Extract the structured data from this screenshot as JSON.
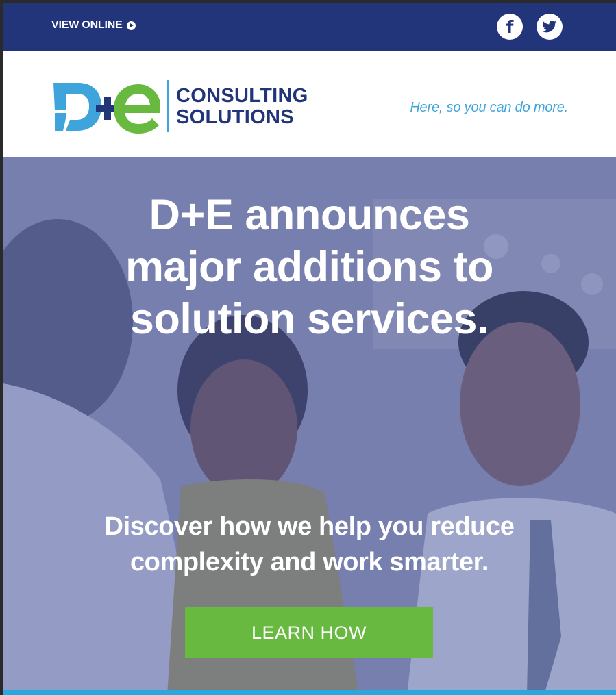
{
  "topbar": {
    "view_online_label": "VIEW ONLINE",
    "social": [
      {
        "icon": "facebook-icon",
        "glyph": "f"
      },
      {
        "icon": "twitter-icon"
      }
    ]
  },
  "header": {
    "logo_mark": "D+E",
    "logo_line1": "CONSULTING",
    "logo_line2": "SOLUTIONS",
    "tagline": "Here, so you can do more."
  },
  "hero": {
    "headline_line1": "D+E announces",
    "headline_line2": "major additions to",
    "headline_line3": "solution services.",
    "subhead_line1": "Discover how we help you reduce",
    "subhead_line2": "complexity and work smarter.",
    "cta_label": "LEARN HOW"
  },
  "colors": {
    "navy": "#22357a",
    "logo_blue": "#3fa4dc",
    "logo_green": "#67b93f",
    "cta_green": "#67b93f",
    "strip_blue": "#29a8e0"
  }
}
